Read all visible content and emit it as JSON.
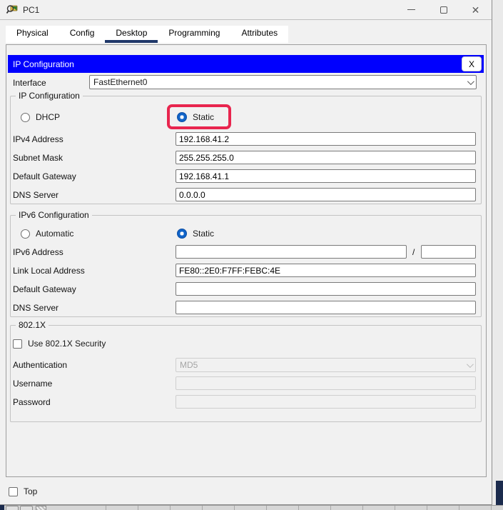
{
  "window": {
    "title": "PC1",
    "icon": "inspect-magnifier-pc-icon",
    "close_glyph": "✕"
  },
  "tabs": [
    {
      "label": "Physical",
      "selected": false
    },
    {
      "label": "Config",
      "selected": false
    },
    {
      "label": "Desktop",
      "selected": true
    },
    {
      "label": "Programming",
      "selected": false
    },
    {
      "label": "Attributes",
      "selected": false
    }
  ],
  "dialog": {
    "title": "IP Configuration",
    "close_label": "X",
    "interface_label": "Interface",
    "interface_value": "FastEthernet0",
    "ip": {
      "legend": "IP Configuration",
      "dhcp_label": "DHCP",
      "static_label": "Static",
      "selected": "Static",
      "fields": [
        {
          "label": "IPv4 Address",
          "value": "192.168.41.2"
        },
        {
          "label": "Subnet Mask",
          "value": "255.255.255.0"
        },
        {
          "label": "Default Gateway",
          "value": "192.168.41.1"
        },
        {
          "label": "DNS Server",
          "value": "0.0.0.0"
        }
      ]
    },
    "ipv6": {
      "legend": "IPv6 Configuration",
      "automatic_label": "Automatic",
      "static_label": "Static",
      "selected": "Static",
      "address_label": "IPv6 Address",
      "address_value": "",
      "prefix_separator": "/",
      "prefix_value": "",
      "fields": [
        {
          "label": "Link Local Address",
          "value": "FE80::2E0:F7FF:FEBC:4E"
        },
        {
          "label": "Default Gateway",
          "value": ""
        },
        {
          "label": "DNS Server",
          "value": ""
        }
      ]
    },
    "dot1x": {
      "legend": "802.1X",
      "checkbox_label": "Use 802.1X Security",
      "checked": false,
      "authentication_label": "Authentication",
      "authentication_value": "MD5",
      "username_label": "Username",
      "username_value": "",
      "password_label": "Password",
      "password_value": ""
    }
  },
  "footer": {
    "top_label": "Top",
    "top_checked": false
  },
  "annotation": {
    "type": "red-highlight-box",
    "target": "Static radio button (IPv4)",
    "color": "#e8254e"
  },
  "colors": {
    "dialog_header": "#0000fe",
    "radio_checked": "#1164c8",
    "tab_underline": "#20386a",
    "window_bg": "#f1f1f1"
  }
}
